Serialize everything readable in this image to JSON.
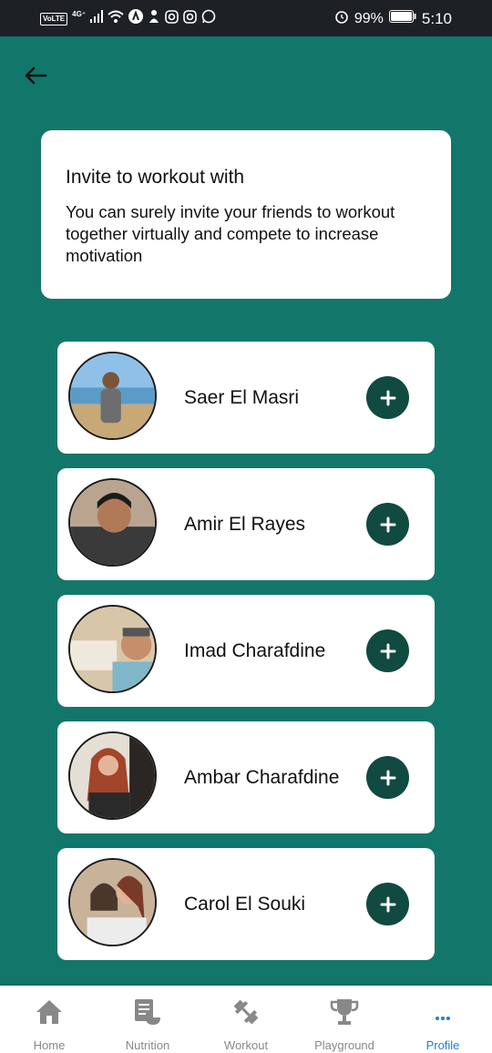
{
  "status_bar": {
    "volte": "VoLTE",
    "network": "4G⁺",
    "battery": "99%",
    "time": "5:10"
  },
  "intro": {
    "title": "Invite to workout with",
    "body": "You can surely invite your friends to workout together virtually and compete to increase motivation"
  },
  "friends": [
    {
      "name": "Saer El Masri"
    },
    {
      "name": "Amir El Rayes"
    },
    {
      "name": "Imad Charafdine"
    },
    {
      "name": "Ambar Charafdine"
    },
    {
      "name": "Carol El Souki"
    }
  ],
  "nav": {
    "items": [
      {
        "label": "Home",
        "icon": "home-icon"
      },
      {
        "label": "Nutrition",
        "icon": "nutrition-icon"
      },
      {
        "label": "Workout",
        "icon": "workout-icon"
      },
      {
        "label": "Playground",
        "icon": "trophy-icon"
      },
      {
        "label": "Profile",
        "icon": "more-icon"
      }
    ],
    "active": "Profile"
  },
  "colors": {
    "background": "#13766a",
    "add_button": "#104a40",
    "active_nav": "#1e7fd6",
    "status_bar": "#1d2126"
  }
}
